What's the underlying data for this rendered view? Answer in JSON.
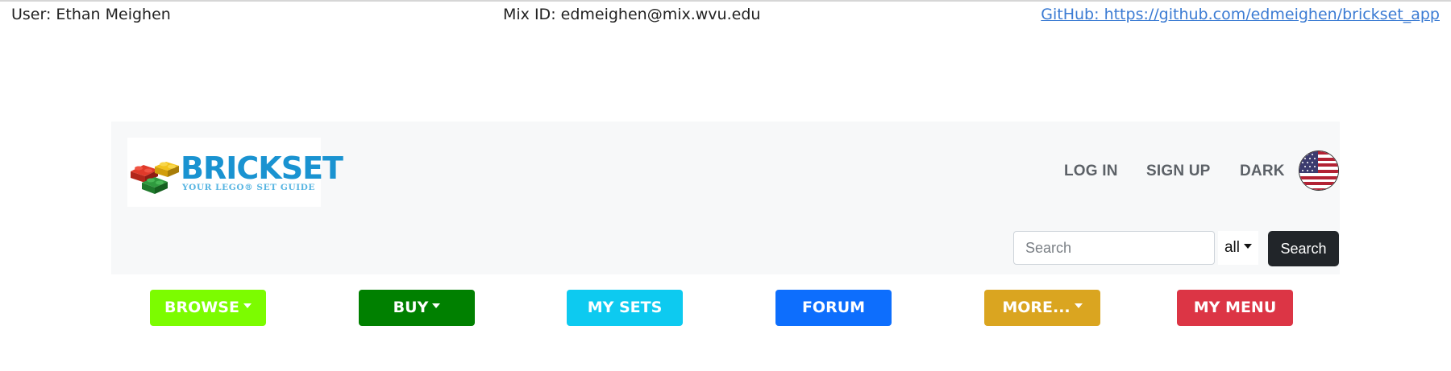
{
  "header": {
    "user": "User: Ethan Meighen",
    "mix_id": "Mix ID: edmeighen@mix.wvu.edu",
    "github": "GitHub: https://github.com/edmeighen/brickset_app"
  },
  "brand": {
    "title": "BRICKSET",
    "subtitle": "YOUR LEGO® SET GUIDE",
    "colors": {
      "title": "#1a93d1",
      "subtitle": "#57b5e2"
    }
  },
  "nav": {
    "login": "LOG IN",
    "signup": "SIGN UP",
    "dark": "DARK",
    "flag_icon": "us-flag-icon"
  },
  "search": {
    "placeholder": "Search",
    "scope": "all",
    "button": "Search"
  },
  "menu": {
    "browse": {
      "label": "BROWSE",
      "color": "#7cfc00"
    },
    "buy": {
      "label": "BUY",
      "color": "#008000"
    },
    "my_sets": {
      "label": "MY SETS",
      "color": "#0dcaf0"
    },
    "forum": {
      "label": "FORUM",
      "color": "#0d6efd"
    },
    "more": {
      "label": "MORE...",
      "color": "#daa520"
    },
    "my_menu": {
      "label": "MY MENU",
      "color": "#dc3545"
    }
  }
}
